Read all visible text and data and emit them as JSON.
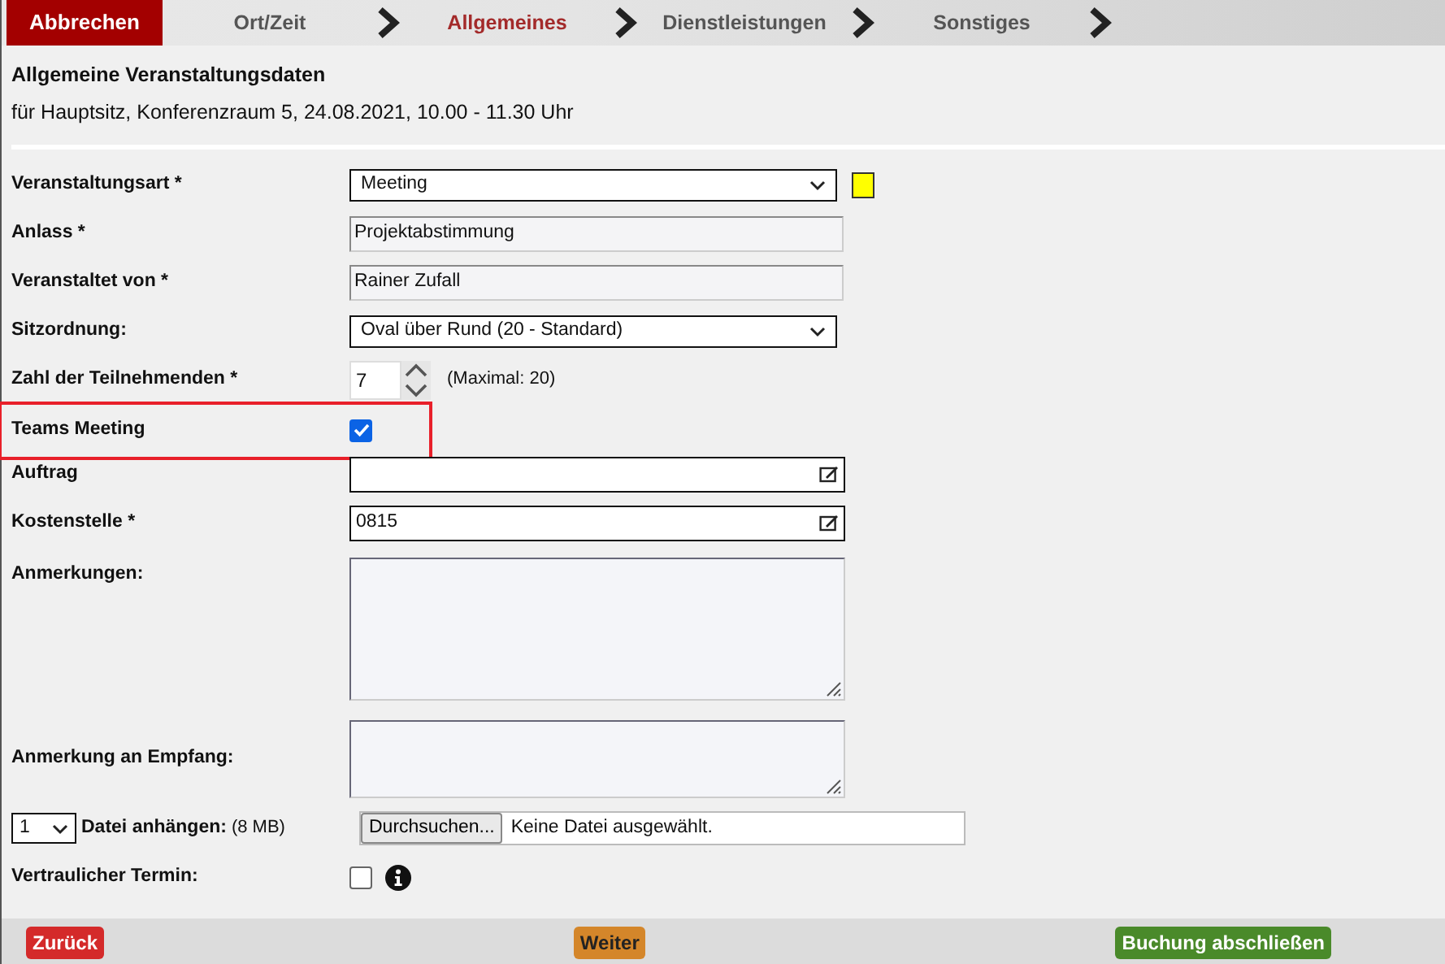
{
  "cancel_button": "Abbrechen",
  "steps": [
    {
      "label": "Ort/Zeit",
      "selected": false
    },
    {
      "label": "Allgemeines",
      "selected": true
    },
    {
      "label": "Dienstleistungen",
      "selected": false
    },
    {
      "label": "Sonstiges",
      "selected": false
    }
  ],
  "heading": "Allgemeine Veranstaltungsdaten",
  "subheading": "für Hauptsitz, Konferenzraum 5, 24.08.2021, 10.00 - 11.30 Uhr",
  "fields": [
    {
      "kind": "select",
      "label": "Veranstaltungsart *",
      "value": "Meeting",
      "color": "#ffff00"
    },
    {
      "kind": "text",
      "label": "Anlass *",
      "value": "Projektabstimmung"
    },
    {
      "kind": "text",
      "label": "Veranstaltet von *",
      "value": "Rainer Zufall"
    },
    {
      "kind": "select",
      "label": "Sitzordnung:",
      "value": "Oval über Rund (20 - Standard)"
    },
    {
      "kind": "number",
      "label": "Zahl der Teilnehmenden *",
      "value": "7",
      "note": "(Maximal: 20)"
    },
    {
      "kind": "checkbox",
      "label": "Teams Meeting",
      "checked": true,
      "highlighted": true
    },
    {
      "kind": "lookup",
      "label": "Auftrag"
    },
    {
      "kind": "lookup",
      "label": "Kostenstelle *",
      "value": "0815"
    },
    {
      "kind": "textarea",
      "label": "Anmerkungen:",
      "tall": true
    },
    {
      "kind": "textarea",
      "label": "Anmerkung an Empfang:",
      "tall": false
    },
    {
      "kind": "file",
      "count": "1",
      "label": "Datei anhängen:",
      "note": "(8 MB)",
      "button": "Durchsuchen...",
      "status": "Keine Datei ausgewählt."
    },
    {
      "kind": "checkbox",
      "label": "Vertraulicher Termin:",
      "checked": false,
      "info": true
    }
  ],
  "footer_buttons": [
    {
      "label": "Zurück",
      "color": "#d42a2a"
    },
    {
      "label": "Weiter",
      "color": "#d4862a"
    },
    {
      "label": "Buchung abschließen",
      "color": "#4a8a2a"
    }
  ]
}
